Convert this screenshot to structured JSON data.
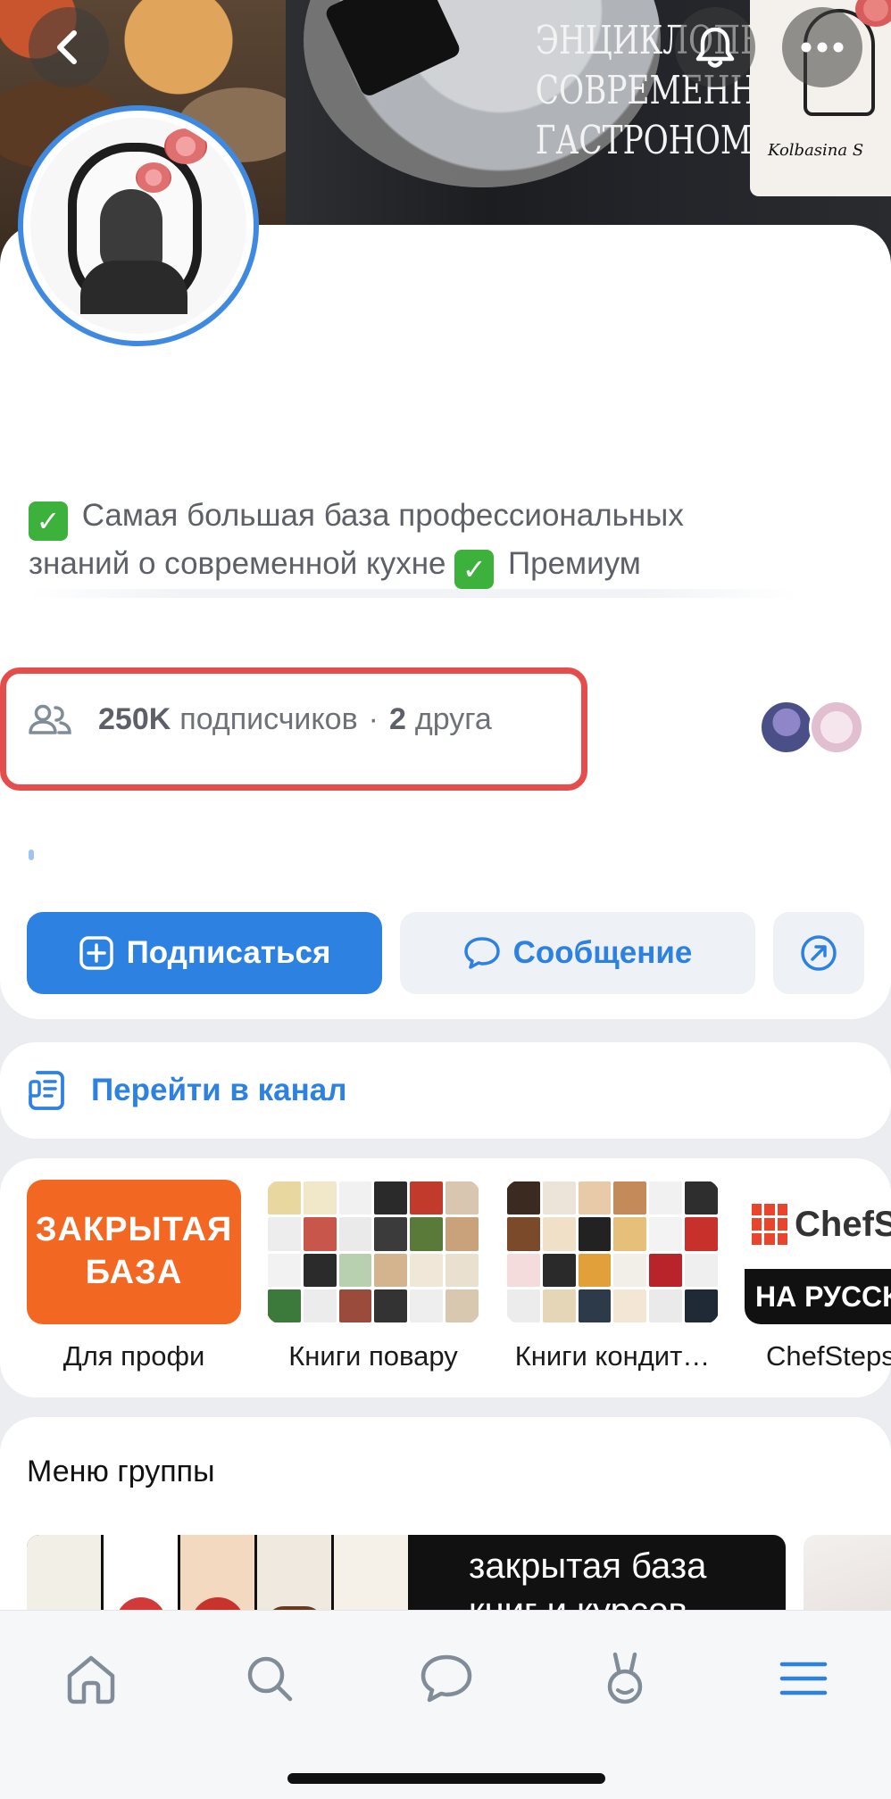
{
  "cover": {
    "title_lines": [
      "ЭНЦИКЛОПЕ",
      "СОВРЕМЕННОЙ",
      "ГАСТРОНОМИИ"
    ],
    "signature": "Kolbasina S"
  },
  "top_buttons": {
    "back_icon": "chevron-left-icon",
    "bell_icon": "bell-icon",
    "more_icon": "more-horizontal-icon"
  },
  "profile": {
    "description_line1": "Самая большая база профессиональных",
    "description_line2_a": "знаний о современной кухне",
    "description_line2_b": "Премиум",
    "check_glyph": "✓",
    "subscribers_count": "250K",
    "subscribers_label": "подписчиков",
    "separator": "·",
    "friends_count": "2",
    "friends_label": "друга"
  },
  "actions": {
    "subscribe": "Подписаться",
    "message": "Сообщение"
  },
  "channel": {
    "label": "Перейти в канал"
  },
  "albums": [
    {
      "caption": "Для профи",
      "thumb_text": "ЗАКРЫТАЯ БАЗА"
    },
    {
      "caption": "Книги повару"
    },
    {
      "caption": "Книги кондит…"
    },
    {
      "caption": "ChefSteps",
      "brand": "ChefSt",
      "bottom": "НА РУССК"
    }
  ],
  "menu": {
    "title": "Меню группы",
    "banner_text_1": "закрытая база",
    "banner_text_2": "книг и курсов"
  },
  "colors": {
    "accent": "#2d81e0",
    "highlight_box": "#e54c4c",
    "avatar_ring": "#3f8ae0",
    "verified_green": "#3cb23c",
    "album_orange": "#f26722"
  }
}
